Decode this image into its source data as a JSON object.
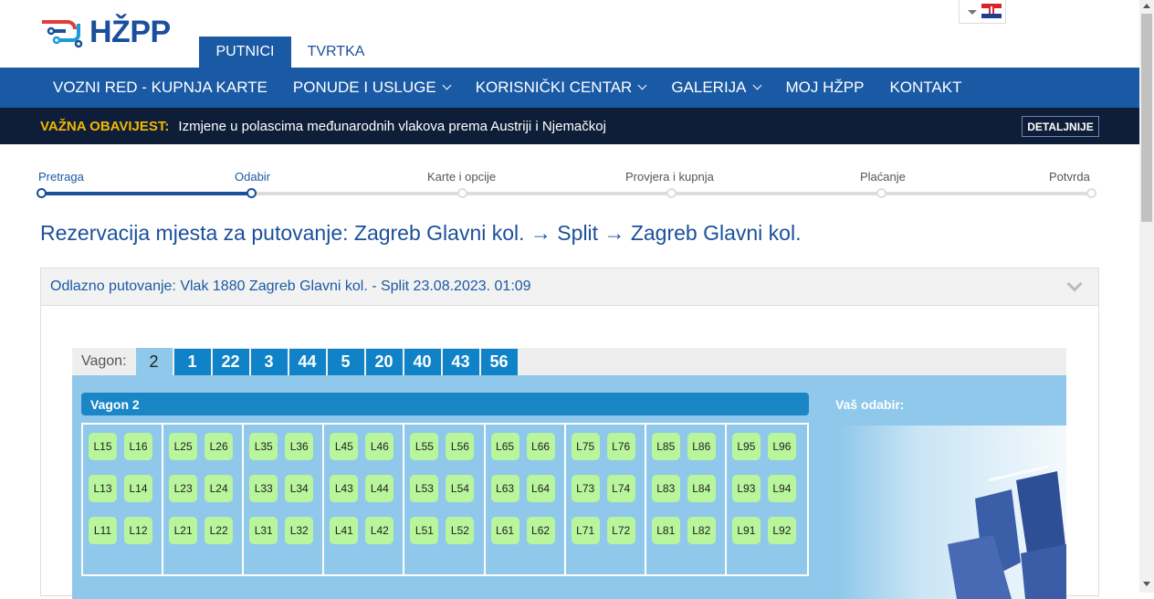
{
  "header": {
    "logo_text": "HŽPP",
    "tabs": [
      {
        "label": "PUTNICI"
      },
      {
        "label": "TVRTKA"
      }
    ]
  },
  "nav": {
    "items": [
      {
        "label": "VOZNI RED - KUPNJA KARTE",
        "dropdown": false
      },
      {
        "label": "PONUDE I USLUGE",
        "dropdown": true
      },
      {
        "label": "KORISNIČKI CENTAR",
        "dropdown": true
      },
      {
        "label": "GALERIJA",
        "dropdown": true
      },
      {
        "label": "MOJ HŽPP",
        "dropdown": false
      },
      {
        "label": "KONTAKT",
        "dropdown": false
      }
    ]
  },
  "notice": {
    "label": "VAŽNA OBAVIJEST:",
    "text": "Izmjene u polascima međunarodnih vlakova prema Austriji i Njemačkoj",
    "button": "DETALJNIJE"
  },
  "steps": [
    {
      "label": "Pretraga",
      "done": true
    },
    {
      "label": "Odabir",
      "done": true
    },
    {
      "label": "Karte i opcije",
      "done": false
    },
    {
      "label": "Provjera i kupnja",
      "done": false
    },
    {
      "label": "Plaćanje",
      "done": false
    },
    {
      "label": "Potvrda",
      "done": false
    }
  ],
  "page_title": "Rezervacija mjesta za putovanje: Zagreb Glavni kol. → Split → Zagreb Glavni kol.",
  "accordion_title": "Odlazno putovanje: Vlak 1880 Zagreb Glavni kol. - Split 23.08.2023. 01:09",
  "wagon_tabs": {
    "label": "Vagon:",
    "tabs": [
      "2",
      "1",
      "22",
      "3",
      "44",
      "5",
      "20",
      "40",
      "43",
      "56"
    ],
    "active": "2"
  },
  "wagon_title": "Vagon 2",
  "selection_label": "Vaš odabir:",
  "compartments": [
    [
      [
        "L15",
        "L16"
      ],
      [
        "L13",
        "L14"
      ],
      [
        "L11",
        "L12"
      ]
    ],
    [
      [
        "L25",
        "L26"
      ],
      [
        "L23",
        "L24"
      ],
      [
        "L21",
        "L22"
      ]
    ],
    [
      [
        "L35",
        "L36"
      ],
      [
        "L33",
        "L34"
      ],
      [
        "L31",
        "L32"
      ]
    ],
    [
      [
        "L45",
        "L46"
      ],
      [
        "L43",
        "L44"
      ],
      [
        "L41",
        "L42"
      ]
    ],
    [
      [
        "L55",
        "L56"
      ],
      [
        "L53",
        "L54"
      ],
      [
        "L51",
        "L52"
      ]
    ],
    [
      [
        "L65",
        "L66"
      ],
      [
        "L63",
        "L64"
      ],
      [
        "L61",
        "L62"
      ]
    ],
    [
      [
        "L75",
        "L76"
      ],
      [
        "L73",
        "L74"
      ],
      [
        "L71",
        "L72"
      ]
    ],
    [
      [
        "L85",
        "L86"
      ],
      [
        "L83",
        "L84"
      ],
      [
        "L81",
        "L82"
      ]
    ],
    [
      [
        "L95",
        "L96"
      ],
      [
        "L93",
        "L94"
      ],
      [
        "L91",
        "L92"
      ]
    ]
  ],
  "colors": {
    "brand_blue": "#1a5aa5",
    "notice_bg": "#0e1e38",
    "notice_label": "#f2b800",
    "seat_available": "#b8f59c",
    "panel_bg": "#8fc8ea",
    "tab_blue": "#1083c8"
  }
}
